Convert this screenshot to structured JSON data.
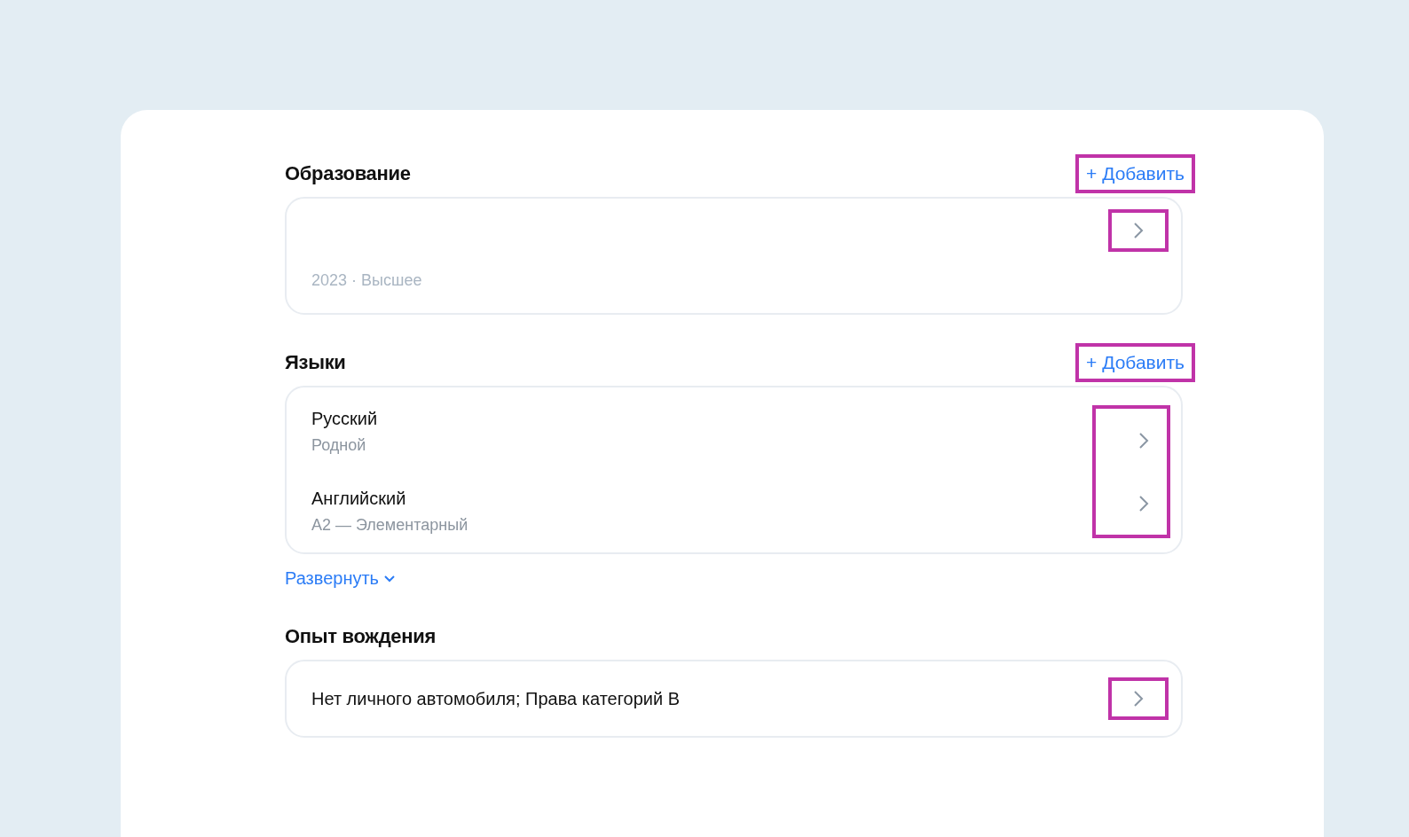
{
  "sections": [
    {
      "kind": "education",
      "title": "Образование",
      "add_button": {
        "label": "+ Добавить",
        "highlighted": true
      },
      "chevron_highlighted": true,
      "subtitle": "2023 · Высшее"
    },
    {
      "kind": "languages",
      "title": "Языки",
      "add_button": {
        "label": "+ Добавить",
        "highlighted": true
      },
      "chevrons_highlighted": true,
      "items": [
        {
          "name": "Русский",
          "level": "Родной"
        },
        {
          "name": "Английский",
          "level": "A2 — Элементарный"
        }
      ],
      "expand_link": "Развернуть"
    },
    {
      "kind": "driving",
      "title": "Опыт вождения",
      "text": "Нет личного автомобиля; Права категорий B",
      "chevron_highlighted": true
    }
  ]
}
